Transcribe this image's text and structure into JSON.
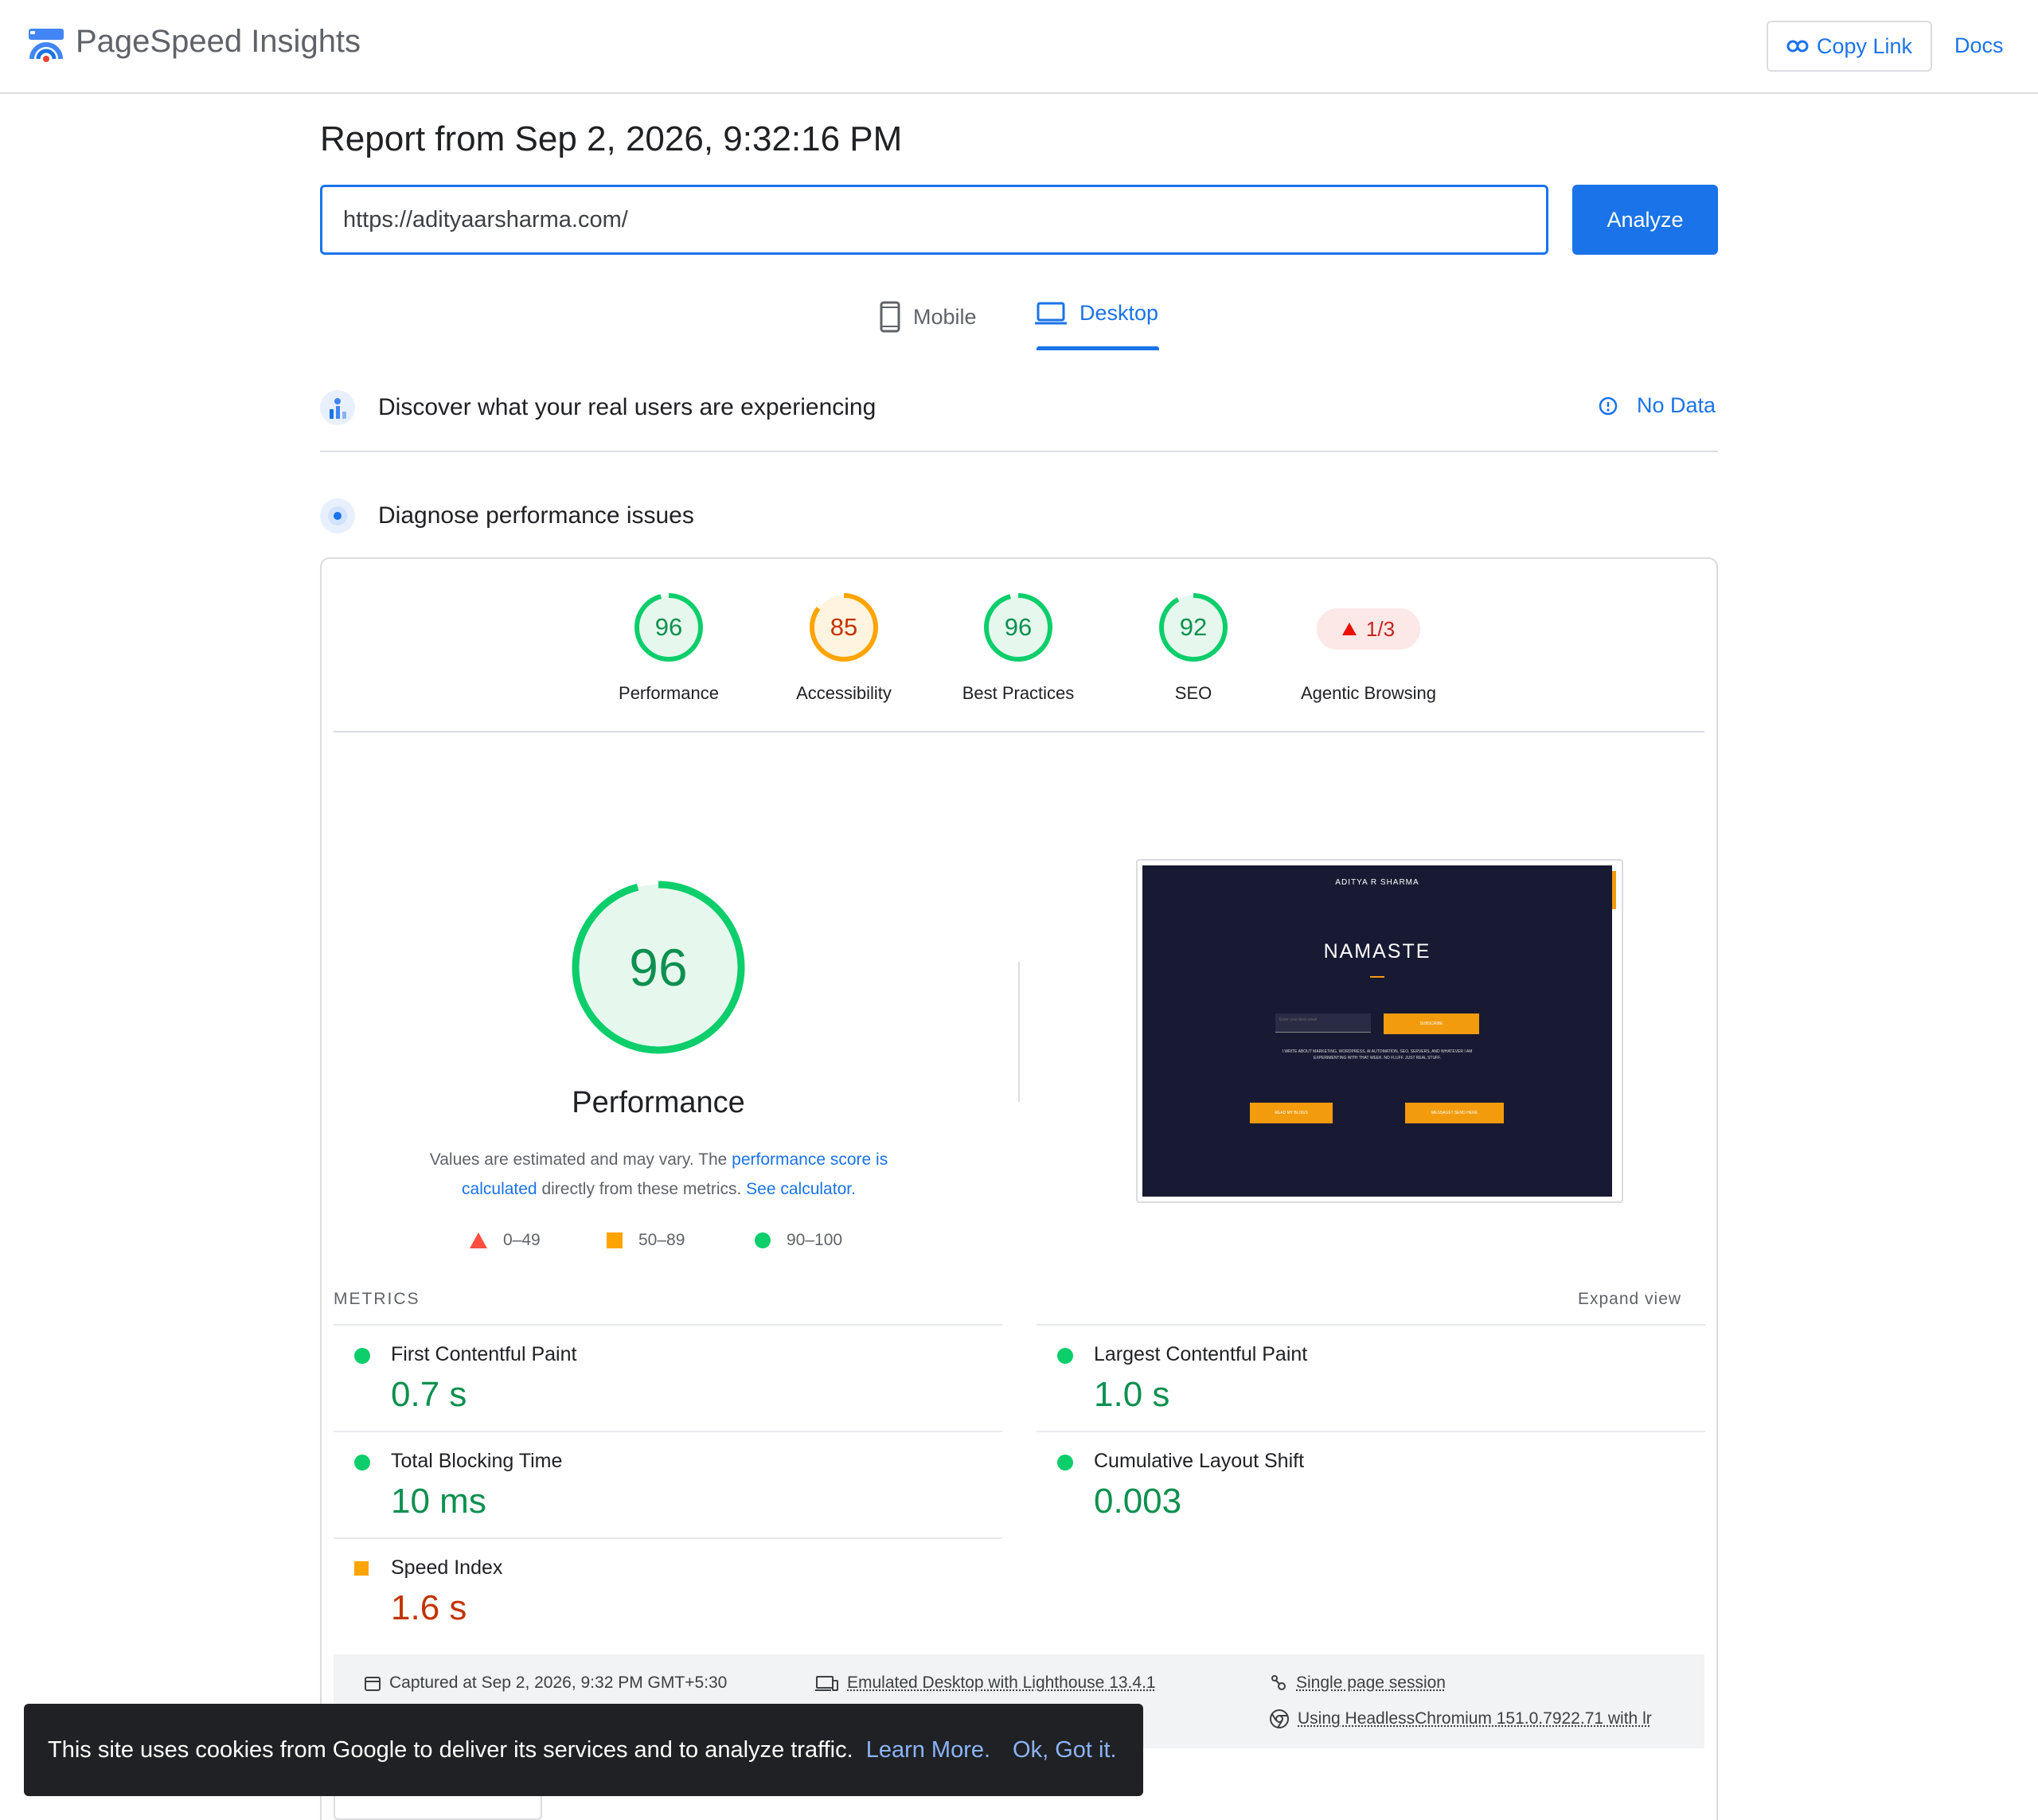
{
  "header": {
    "brand": "PageSpeed Insights",
    "copy_link": "Copy Link",
    "docs": "Docs"
  },
  "report": {
    "title": "Report from Sep 2, 2026, 9:32:16 PM",
    "url": "https://adityaarsharma.com/",
    "analyze": "Analyze"
  },
  "tabs": {
    "mobile": "Mobile",
    "desktop": "Desktop",
    "active": "Desktop"
  },
  "field_section": {
    "title": "Discover what your real users are experiencing",
    "status": "No Data"
  },
  "lab_section": {
    "title": "Diagnose performance issues"
  },
  "categories": [
    {
      "label": "Performance",
      "score": "96",
      "color": "#0cce6b"
    },
    {
      "label": "Accessibility",
      "score": "85",
      "color": "#ffa400"
    },
    {
      "label": "Best Practices",
      "score": "96",
      "color": "#0cce6b"
    },
    {
      "label": "SEO",
      "score": "92",
      "color": "#0cce6b"
    },
    {
      "label": "Agentic Browsing",
      "score": "1/3",
      "color": "#ff4e42"
    }
  ],
  "performance": {
    "score": "96",
    "label": "Performance",
    "desc_pre": "Values are estimated and may vary. The ",
    "desc_link1": "performance score is calculated",
    "desc_mid": " directly from these metrics. ",
    "desc_link2": "See calculator.",
    "legend": {
      "fail": "0–49",
      "average": "50–89",
      "pass": "90–100"
    }
  },
  "screenshot": {
    "site_name": "ADITYA R SHARMA",
    "headline": "NAMASTE",
    "input_placeholder": "Enter your best email",
    "subscribe": "SUBSCRIBE",
    "blurb": "I WRITE ABOUT MARKETING, WORDPRESS, AI AUTOMATION, SEO, SERVERS, AND WHATEVER I AM EXPERIMENTING WITH THAT WEEK. NO FLUFF. JUST REAL STUFF.",
    "btn_left": "READ MY BLOGS",
    "btn_right": "MESSAGE? SEND HERE"
  },
  "metrics": {
    "heading": "METRICS",
    "expand": "Expand view",
    "fcp": {
      "name": "First Contentful Paint",
      "value": "0.7 s"
    },
    "lcp": {
      "name": "Largest Contentful Paint",
      "value": "1.0 s"
    },
    "tbt": {
      "name": "Total Blocking Time",
      "value": "10 ms"
    },
    "cls": {
      "name": "Cumulative Layout Shift",
      "value": "0.003"
    },
    "si": {
      "name": "Speed Index",
      "value": "1.6 s"
    }
  },
  "footer": {
    "captured": "Captured at Sep 2, 2026, 9:32 PM GMT+5:30",
    "emulated": "Emulated Desktop with Lighthouse 13.4.1",
    "session": "Single page session",
    "browser": "Using HeadlessChromium 151.0.7922.71 with lr"
  },
  "cookie": {
    "text": "This site uses cookies from Google to deliver its services and to analyze traffic.",
    "learn": "Learn More.",
    "ok": "Ok, Got it."
  },
  "colors": {
    "accent": "#1a73e8",
    "pass": "#0cce6b",
    "average": "#ffa400",
    "fail": "#ff4e42"
  }
}
